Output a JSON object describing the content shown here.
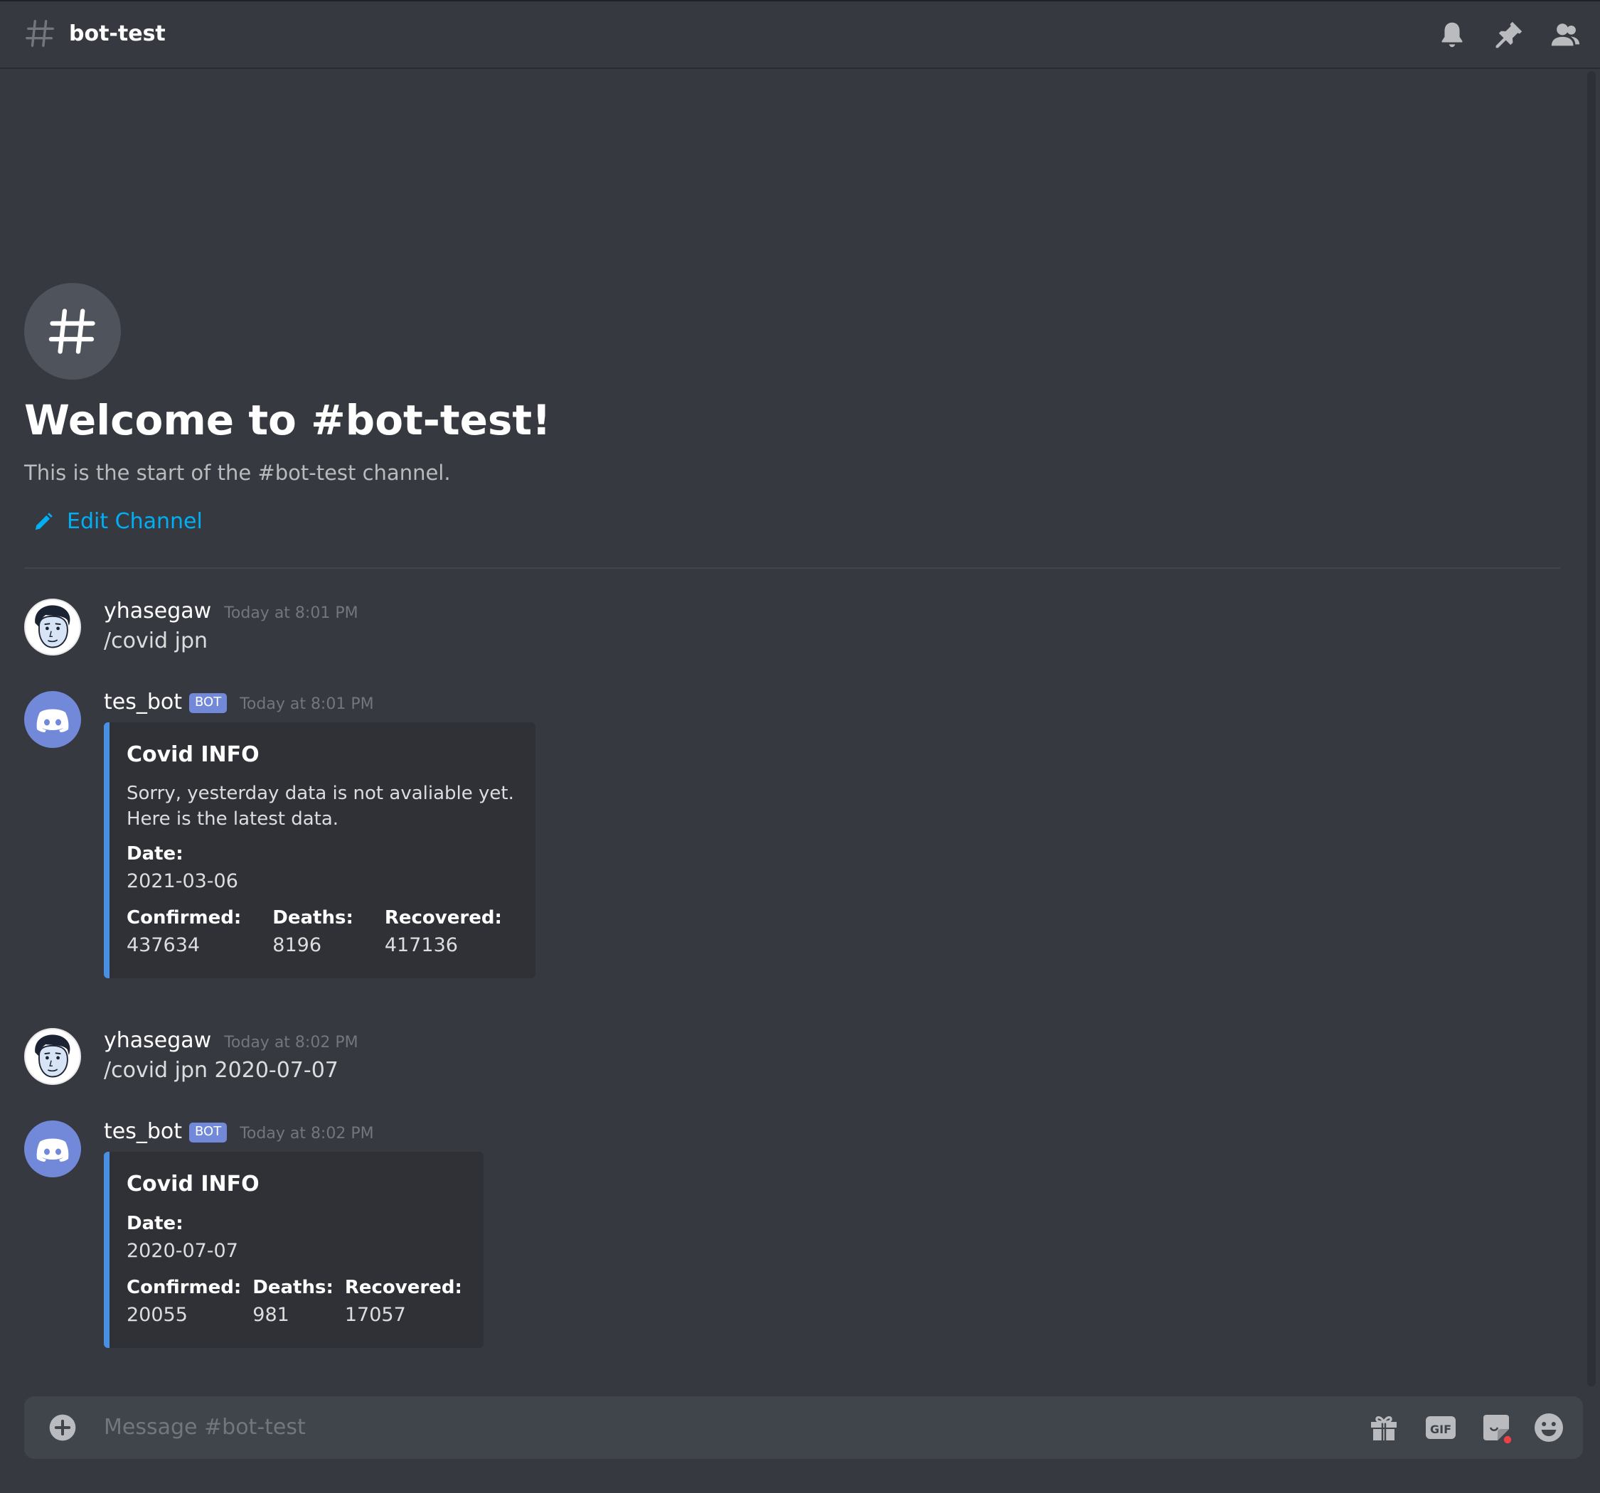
{
  "header": {
    "channel_name": "bot-test",
    "icons": [
      "notification-bell-icon",
      "pin-icon",
      "member-list-icon"
    ]
  },
  "welcome": {
    "title": "Welcome to #bot-test!",
    "subtitle": "This is the start of the #bot-test channel.",
    "edit_label": "Edit Channel"
  },
  "messages": [
    {
      "author": "yhasegaw",
      "time": "Today at 8:01 PM",
      "text": "/covid jpn"
    },
    {
      "author": "tes_bot",
      "badge": "BOT",
      "time": "Today at 8:01 PM",
      "embed": {
        "title": "Covid INFO",
        "desc1": "Sorry, yesterday data is not avaliable yet.",
        "desc2": "Here is the latest data.",
        "date_label": "Date:",
        "date_value": "2021-03-06",
        "confirmed_label": "Confirmed:",
        "confirmed_value": "437634",
        "deaths_label": "Deaths:",
        "deaths_value": "8196",
        "recovered_label": "Recovered:",
        "recovered_value": "417136"
      }
    },
    {
      "author": "yhasegaw",
      "time": "Today at 8:02 PM",
      "text": "/covid jpn 2020-07-07"
    },
    {
      "author": "tes_bot",
      "badge": "BOT",
      "time": "Today at 8:02 PM",
      "embed": {
        "title": "Covid INFO",
        "date_label": "Date:",
        "date_value": "2020-07-07",
        "confirmed_label": "Confirmed:",
        "confirmed_value": "20055",
        "deaths_label": "Deaths:",
        "deaths_value": "981",
        "recovered_label": "Recovered:",
        "recovered_value": "17057"
      }
    }
  ],
  "composer": {
    "placeholder": "Message #bot-test",
    "gif_label": "GIF",
    "icons": [
      "add-attachment-icon",
      "gift-icon",
      "gif-icon",
      "sticker-icon",
      "emoji-icon"
    ]
  },
  "colors": {
    "background": "#36393f",
    "embed_bg": "#2f3136",
    "embed_accent": "#4a90e2",
    "link": "#00aff4",
    "bot_badge": "#7289da"
  }
}
